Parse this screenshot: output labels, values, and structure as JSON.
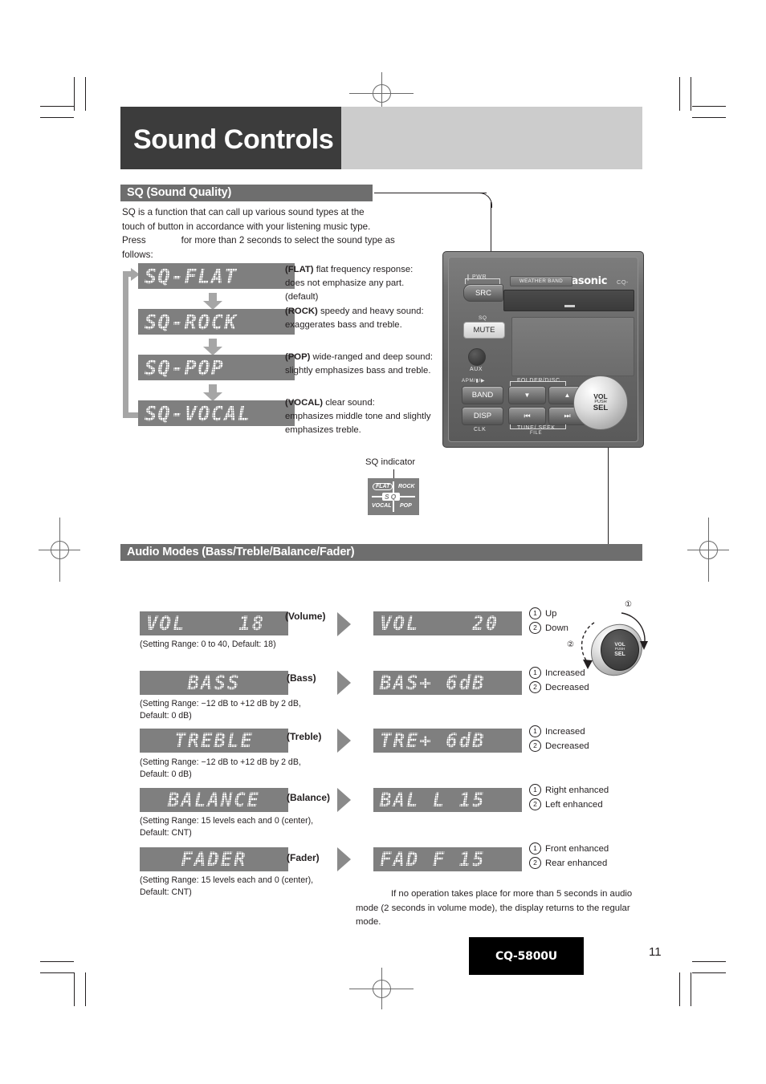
{
  "page": {
    "title": "Sound Controls",
    "model_badge": "CQ-5800U",
    "page_number": "11"
  },
  "sq_section": {
    "heading": "SQ (Sound Quality)",
    "intro_lines": [
      "SQ is a function that can call up various sound types at the",
      "touch of button in accordance with your listening music type."
    ],
    "press_prefix": "Press",
    "press_suffix": "for more than 2 seconds to select the sound type as",
    "press_tail": "follows:",
    "steps": [
      {
        "display": "SQ-FLAT",
        "bold": "(FLAT)",
        "desc_line1": "flat frequency response:",
        "desc_line2": "does not emphasize any part.",
        "desc_line3": "(default)"
      },
      {
        "display": "SQ-ROCK",
        "bold": "(ROCK)",
        "desc_line1": "speedy and heavy sound:",
        "desc_line2": "exaggerates bass and treble.",
        "desc_line3": ""
      },
      {
        "display": "SQ-POP",
        "bold": "(POP)",
        "desc_line1": "wide-ranged and deep sound:",
        "desc_line2": "slightly emphasizes bass and treble.",
        "desc_line3": ""
      },
      {
        "display": "SQ-VOCAL",
        "bold": "(VOCAL)",
        "desc_line1": "clear sound:",
        "desc_line2": "emphasizes middle tone and slightly",
        "desc_line3": "emphasizes treble."
      }
    ],
    "sq_indicator_label": "SQ indicator",
    "sq_indicator_segments": {
      "flat": "FLAT",
      "rock": "ROCK",
      "vocal": "VOCAL",
      "pop": "POP",
      "center": "SQ"
    }
  },
  "head_unit": {
    "brand": "Panasonic",
    "model": "CQ-",
    "weather_band": "WEATHER BAND",
    "pwr_label": "PWR",
    "src_button": "SRC",
    "sq_label": "SQ",
    "mute_button": "MUTE",
    "aux_label": "AUX",
    "apm_label": "APM/▮/▶",
    "folder_disc_label": "FOLDER/DISC",
    "band_button": "BAND",
    "disp_button": "DISP",
    "clk_label": "CLK",
    "up_button": "▲",
    "down_button": "▼",
    "prev_button": "⏮",
    "next_button": "⏭",
    "tune_seek_label": "TUNE/ SEEK",
    "file_label": "FILE",
    "vol_knob": {
      "line1": "VOL",
      "line2": "PUSH",
      "line3": "SEL"
    }
  },
  "audio_modes": {
    "heading": "Audio Modes (Bass/Treble/Balance/Fader)",
    "rows": [
      {
        "display_left": "VOL    18",
        "align": "left",
        "label": "(Volume)",
        "range": "(Setting Range: 0 to 40, Default: 18)",
        "range2": "",
        "display_right": "VOL    20",
        "opt1": "Up",
        "opt2": "Down"
      },
      {
        "display_left": "BASS",
        "align": "center",
        "label": "(Bass)",
        "range": "(Setting Range: −12 dB to +12 dB by 2 dB,",
        "range2": "Default: 0 dB)",
        "display_right": "BAS+ 6dB",
        "opt1": "Increased",
        "opt2": "Decreased"
      },
      {
        "display_left": "TREBLE",
        "align": "center",
        "label": "(Treble)",
        "range": "(Setting Range: −12 dB to +12 dB by 2 dB,",
        "range2": "Default: 0 dB)",
        "display_right": "TRE+ 6dB",
        "opt1": "Increased",
        "opt2": "Decreased"
      },
      {
        "display_left": "BALANCE",
        "align": "center",
        "label": "(Balance)",
        "range": "(Setting Range: 15 levels each and 0 (center),",
        "range2": "Default: CNT)",
        "display_right": "BAL L 15",
        "opt1": "Right enhanced",
        "opt2": "Left enhanced"
      },
      {
        "display_left": "FADER",
        "align": "center",
        "label": "(Fader)",
        "range": "(Setting Range: 15 levels each and 0 (center),",
        "range2": "Default: CNT)",
        "display_right": "FAD F 15",
        "opt1": "Front enhanced",
        "opt2": "Rear enhanced"
      }
    ],
    "knob_diagram": {
      "num1": "①",
      "num2": "②",
      "face": {
        "line1": "VOL",
        "line2": "PUSH",
        "line3": "SEL"
      }
    },
    "note_lines": [
      "If no operation takes place for more than 5 seconds in audio",
      "mode (2 seconds in volume mode), the display returns to the regular",
      "mode."
    ]
  },
  "colors": {
    "title_block": "#3c3c3c",
    "title_band": "#cccccc",
    "section_bar": "#6e6e6e",
    "lcd_bg": "#7f7f7f",
    "lcd_text": "#ffffff",
    "arrow": "#a6a6a6"
  }
}
